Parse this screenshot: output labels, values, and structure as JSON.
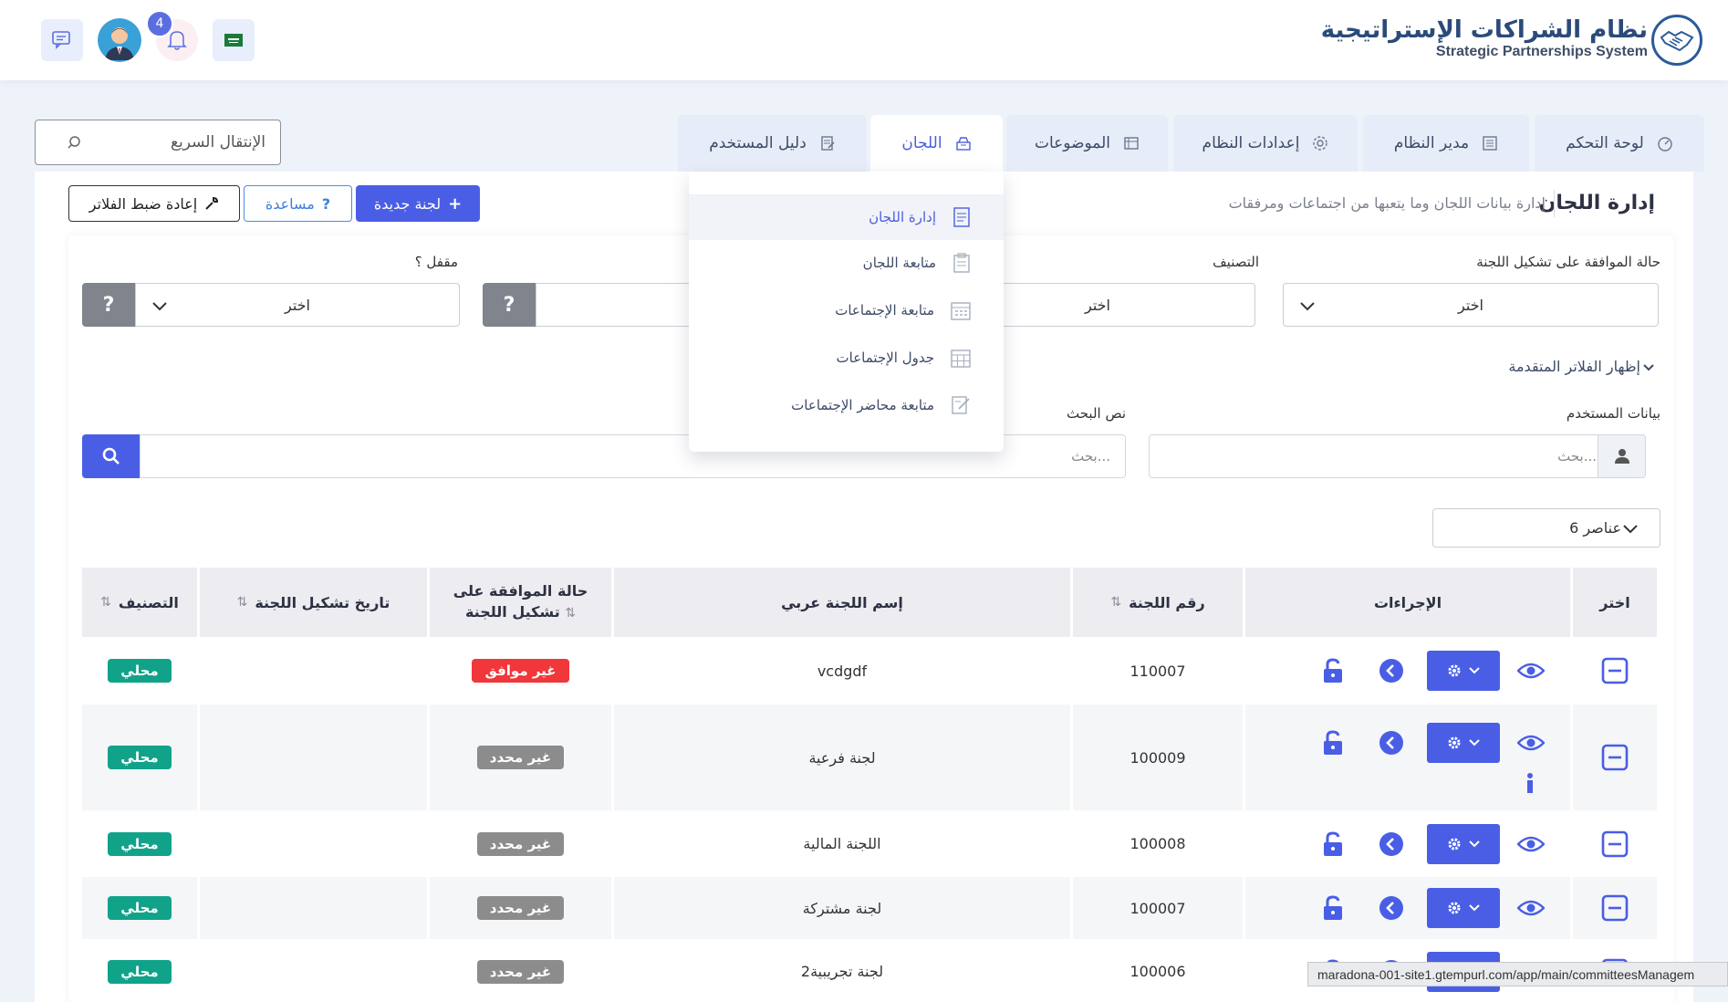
{
  "header": {
    "logo_title": "نظام الشراكات الإستراتيجية",
    "logo_subtitle": "Strategic Partnerships System",
    "notification_count": "4"
  },
  "nav": {
    "tabs": [
      {
        "label": "لوحة التحكم",
        "icon": "dashboard-icon"
      },
      {
        "label": "مدير النظام",
        "icon": "admin-icon"
      },
      {
        "label": "إعدادات النظام",
        "icon": "gear-icon"
      },
      {
        "label": "الموضوعات",
        "icon": "topics-icon"
      },
      {
        "label": "اللجان",
        "icon": "committees-icon"
      },
      {
        "label": "دليل المستخدم",
        "icon": "guide-icon"
      }
    ],
    "quick_search": "الإنتقال السريع"
  },
  "dropdown": {
    "items": [
      "إدارة اللجان",
      "متابعة اللجان",
      "متابعة الإجتماعات",
      "جدول الإجتماعات",
      "متابعة محاضر الإجتماعات"
    ]
  },
  "page": {
    "title": "إدارة اللجان",
    "subtitle": "إدارة بيانات اللجان وما يتعبها من اجتماعات ومرفقات",
    "new_button": "لجنة جديدة",
    "help_button": "مساعدة",
    "reset_button": "إعادة ضبط الفلاتر"
  },
  "filters": {
    "approval_label": "حالة الموافقة على تشكيل اللجنة",
    "classification_label": "التصنيف",
    "locked_label": "مقفل ؟",
    "select_placeholder": "اختر",
    "help_glyph": "?",
    "advanced_toggle": "إظهار الفلاتر المتقدمة",
    "user_data_label": "بيانات المستخدم",
    "search_text_label": "نص البحث",
    "search_placeholder": "بحث..."
  },
  "page_size": "6 عناصر",
  "table": {
    "headers": {
      "select": "اختر",
      "actions": "الإجراءات",
      "number": "رقم اللجنة",
      "name": "إسم اللجنة عربي",
      "approval_line1": "حالة الموافقة على",
      "approval_line2": "تشكيل اللجنة",
      "date": "تاريخ تشكيل اللجنة",
      "classification": "التصنيف",
      "sort_glyph": "⇅"
    },
    "rows": [
      {
        "number": "110007",
        "name": "vcdgdf",
        "approval": "غير موافق",
        "classification": "محلي"
      },
      {
        "number": "100009",
        "name": "لجنة فرعية",
        "approval": "غير محدد",
        "classification": "محلي"
      },
      {
        "number": "100008",
        "name": "اللجنة المالية",
        "approval": "غير محدد",
        "classification": "محلي"
      },
      {
        "number": "100007",
        "name": "لجنة مشتركة",
        "approval": "غير محدد",
        "classification": "محلي"
      },
      {
        "number": "100006",
        "name": "لجنة تجريبية2",
        "approval": "غير محدد",
        "classification": "محلي"
      }
    ]
  },
  "status_url": "maradona-001-site1.gtempurl.com/app/main/committeesManagem",
  "colors": {
    "primary": "#4a5ee5",
    "success": "#11a38a",
    "danger": "#f0373a",
    "muted": "#8c8c8c"
  }
}
